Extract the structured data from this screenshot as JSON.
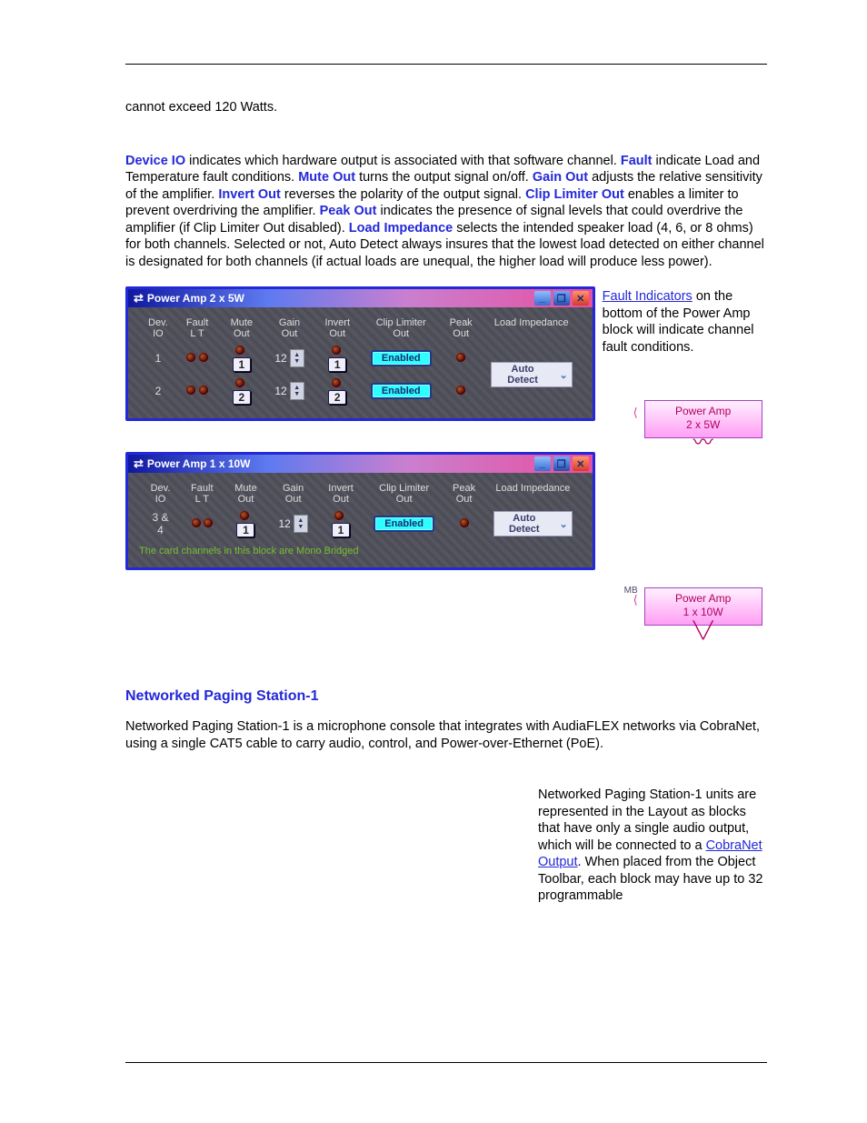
{
  "intro_line": "cannot exceed 120 Watts.",
  "para_controls": {
    "em_devio": "Device IO",
    "t_devio": " indicates which hardware output is associated with that software channel. ",
    "em_fault": "Fault",
    "t_fault": " indicate Load and Temperature fault conditions. ",
    "em_mute": "Mute Out",
    "t_mute": " turns the output signal on/off. ",
    "em_gain": "Gain Out",
    "t_gain": " adjusts the relative sensitivity of the amplifier. ",
    "em_inv": "Invert Out",
    "t_inv": " reverses the polarity of the output signal. ",
    "em_clip": "Clip Limiter Out",
    "t_clip": " enables a limiter to prevent overdriving the amplifier. ",
    "em_peak": "Peak Out",
    "t_peak": " indicates the presence of signal levels that could overdrive the amplifier (if Clip Limiter Out disabled). ",
    "em_load": "Load Impedance",
    "t_load": " selects the intended speaker load (4, 6, or 8 ohms) for both channels. Selected or not, Auto Detect always insures that the lowest load detected on either channel is designated for both channels (if actual loads are unequal, the higher load will produce less power)."
  },
  "side_fault": {
    "link": "Fault Indicators",
    "text_after": " on the bottom of the Power Amp block will indicate channel fault conditions."
  },
  "pa_headers": {
    "dev1": "Dev.",
    "dev2": "IO",
    "f1": "Fault",
    "f2": "L   T",
    "mute1": "Mute",
    "mute2": "Out",
    "gain1": "Gain",
    "gain2": "Out",
    "inv1": "Invert",
    "inv2": "Out",
    "clip1": "Clip Limiter",
    "clip2": "Out",
    "peak1": "Peak",
    "peak2": "Out",
    "load": "Load Impedance"
  },
  "amp5": {
    "title": "Power Amp 2 x 5W",
    "rows": [
      {
        "io": "1",
        "mute_lbl": "1",
        "gain": "12",
        "inv_lbl": "1",
        "enabled": "Enabled"
      },
      {
        "io": "2",
        "mute_lbl": "2",
        "gain": "12",
        "inv_lbl": "2",
        "enabled": "Enabled"
      }
    ],
    "dropdown": "Auto Detect",
    "block_line1": "Power Amp",
    "block_line2": "2 x 5W"
  },
  "amp10": {
    "title": "Power Amp 1 x 10W",
    "rows": [
      {
        "io": "3 & 4",
        "mute_lbl": "1",
        "gain": "12",
        "inv_lbl": "1",
        "enabled": "Enabled"
      }
    ],
    "dropdown": "Auto Detect",
    "note": "The card channels in this block are Mono Bridged",
    "block_line1": "Power Amp",
    "block_line2": "1 x 10W",
    "mb_tag": "MB"
  },
  "nps": {
    "heading": "Networked Paging Station-1",
    "intro": "Networked Paging Station-1 is a microphone console that integrates with AudiaFLEX networks via CobraNet, using a single CAT5 cable to carry audio, control, and Power-over-Ethernet (PoE).",
    "right1": "Networked Paging Station-1 units are represented in the Layout as blocks that have only a single audio output, which will be connected to a ",
    "right_link": "CobraNet Output",
    "right2": ". When placed from the Object Toolbar, each block may have up to 32 programmable"
  },
  "icons": {
    "min": "_",
    "max": "❐",
    "close": "✕",
    "chev": "⌄",
    "exchange": "⇄",
    "up": "▲",
    "down": "▼"
  }
}
